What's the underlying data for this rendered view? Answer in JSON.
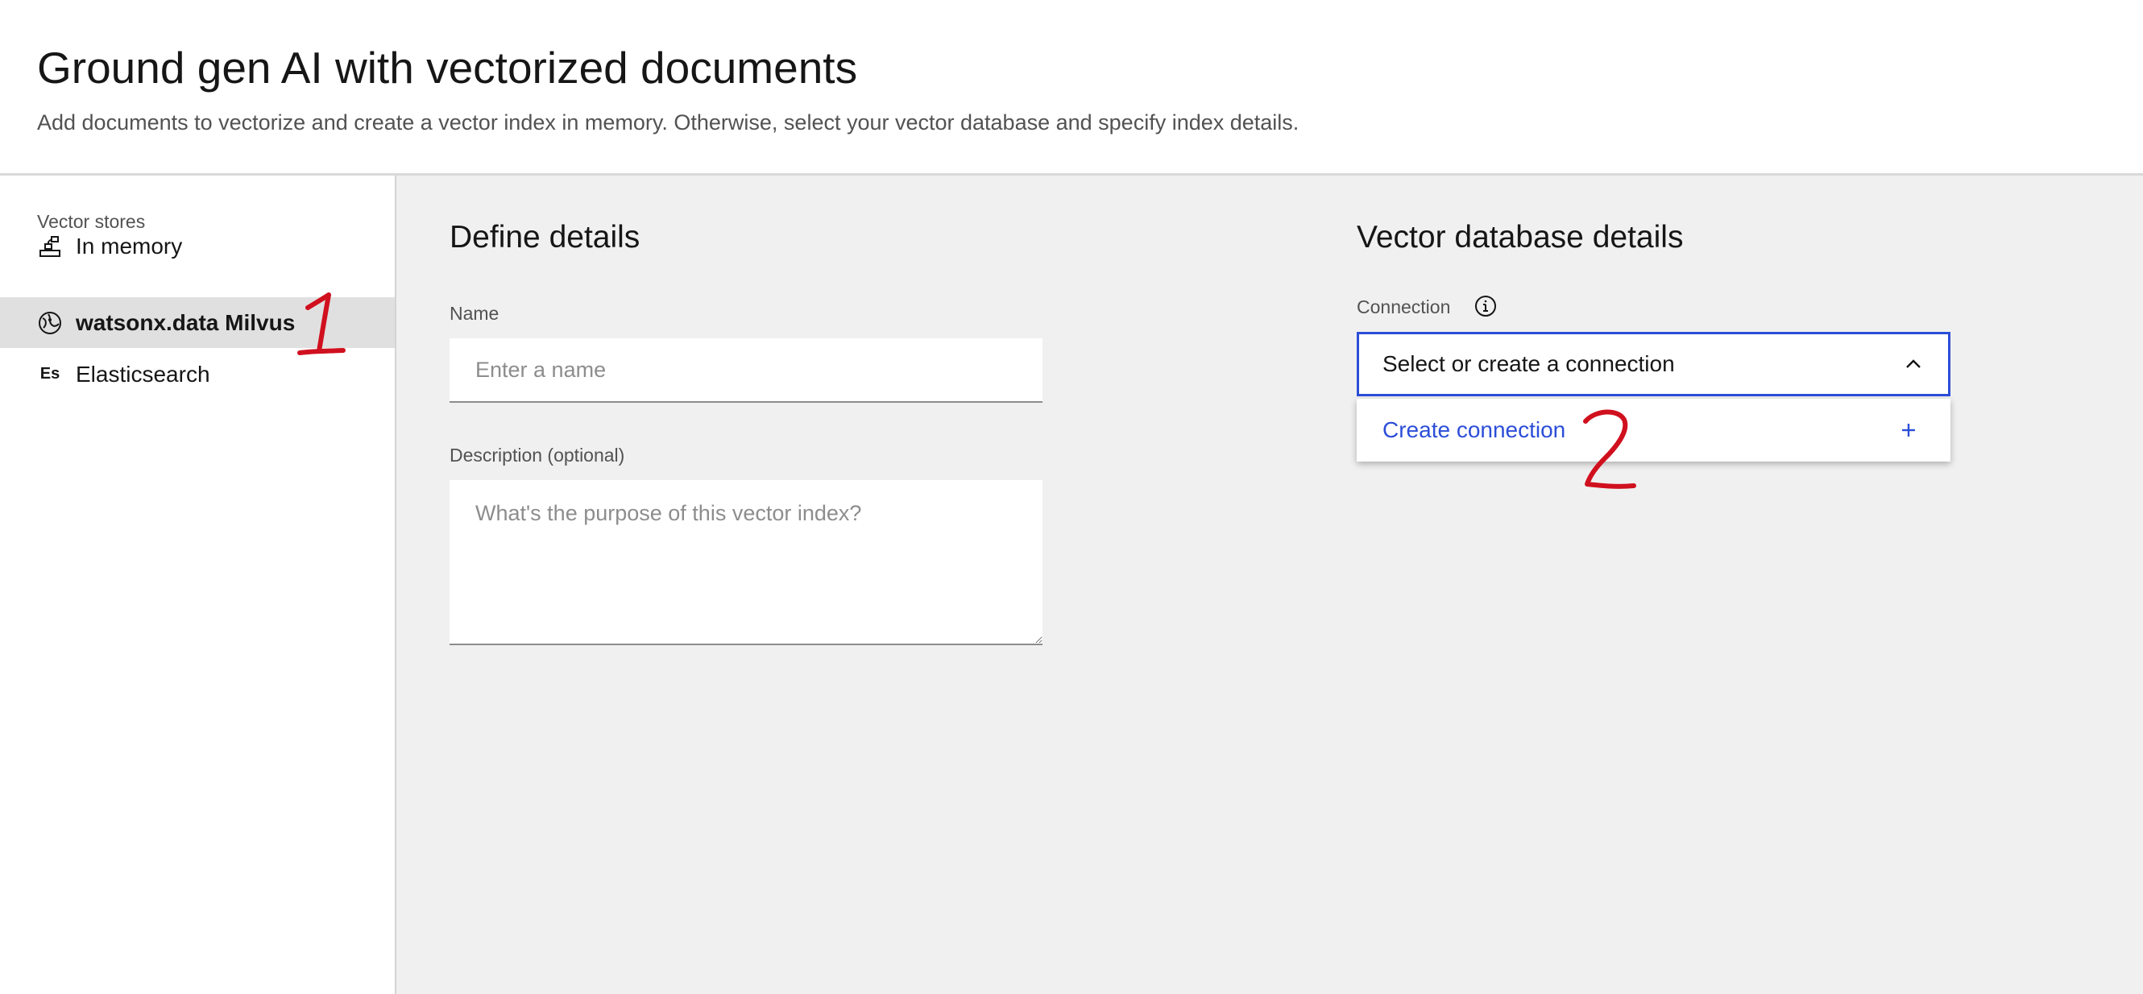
{
  "header": {
    "title": "Ground gen AI with vectorized documents",
    "subtitle": "Add documents to vectorize and create a vector index in memory. Otherwise, select your vector database and specify index details."
  },
  "sidebar": {
    "heading": "Vector stores",
    "items": [
      {
        "label": "In memory",
        "icon": "in-memory-icon",
        "selected": false
      },
      {
        "label": "watsonx.data Milvus",
        "icon": "milvus-icon",
        "selected": true
      },
      {
        "label": "Elasticsearch",
        "icon": "elasticsearch-icon",
        "icon_text": "Es",
        "selected": false
      }
    ]
  },
  "define_details": {
    "title": "Define details",
    "name_label": "Name",
    "name_placeholder": "Enter a name",
    "name_value": "",
    "description_label": "Description (optional)",
    "description_placeholder": "What's the purpose of this vector index?",
    "description_value": ""
  },
  "vector_db": {
    "title": "Vector database details",
    "connection_label": "Connection",
    "connection_value": "Select or create a connection",
    "dropdown_open": true,
    "menu_items": [
      {
        "label": "Create connection",
        "icon": "plus-icon"
      }
    ]
  },
  "annotations": [
    {
      "text": "1",
      "color": "#d0101e"
    },
    {
      "text": "2",
      "color": "#d0101e"
    }
  ],
  "colors": {
    "accent": "#2c4ed8",
    "selected_bg": "#e0e0e0",
    "main_bg": "#f0f0f0",
    "annotation": "#d0101e"
  }
}
